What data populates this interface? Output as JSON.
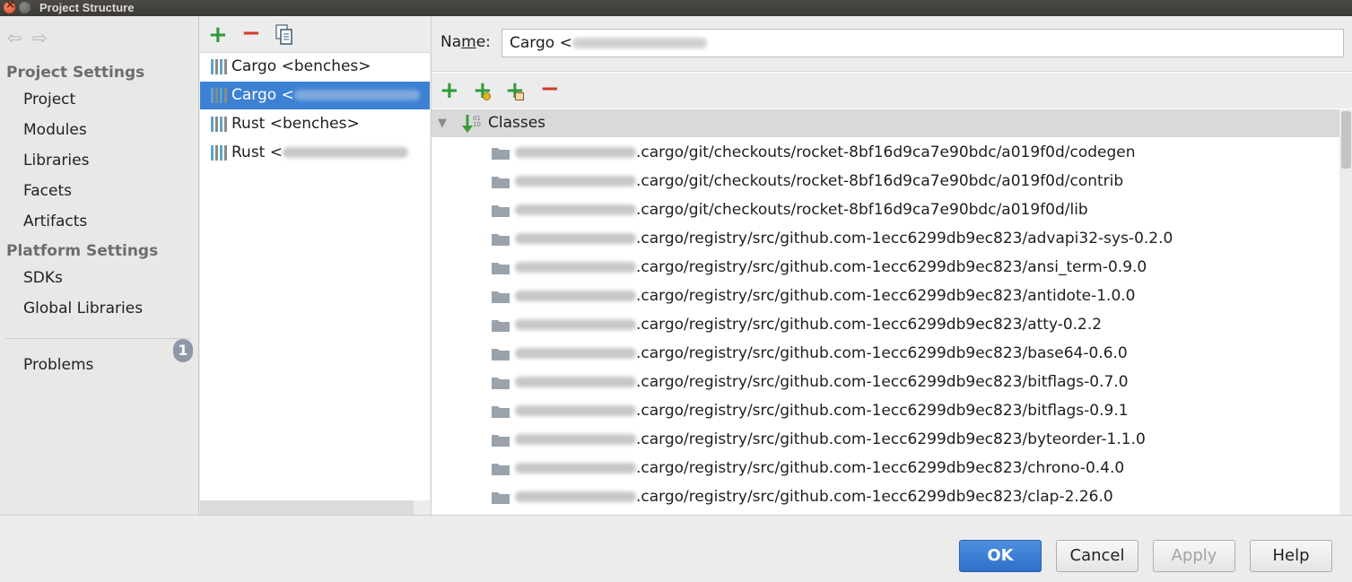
{
  "window": {
    "title": "Project Structure"
  },
  "sidebar": {
    "project_settings_heading": "Project Settings",
    "project_items": [
      "Project",
      "Modules",
      "Libraries",
      "Facets",
      "Artifacts"
    ],
    "platform_settings_heading": "Platform Settings",
    "platform_items": [
      "SDKs",
      "Global Libraries"
    ],
    "problems_label": "Problems",
    "problems_count": "1"
  },
  "libraries": {
    "items": [
      {
        "name": "Cargo <benches>",
        "selected": false,
        "redacted": false
      },
      {
        "name": "Cargo <",
        "selected": true,
        "redacted": true
      },
      {
        "name": "Rust <benches>",
        "selected": false,
        "redacted": false
      },
      {
        "name": "Rust <",
        "selected": false,
        "redacted": true
      }
    ]
  },
  "detail": {
    "name_label_prefix": "Na",
    "name_label_mnemonic": "m",
    "name_label_suffix": "e:",
    "name_value": "Cargo <",
    "classes_label": "Classes",
    "paths": [
      ".cargo/git/checkouts/rocket-8bf16d9ca7e90bdc/a019f0d/codegen",
      ".cargo/git/checkouts/rocket-8bf16d9ca7e90bdc/a019f0d/contrib",
      ".cargo/git/checkouts/rocket-8bf16d9ca7e90bdc/a019f0d/lib",
      ".cargo/registry/src/github.com-1ecc6299db9ec823/advapi32-sys-0.2.0",
      ".cargo/registry/src/github.com-1ecc6299db9ec823/ansi_term-0.9.0",
      ".cargo/registry/src/github.com-1ecc6299db9ec823/antidote-1.0.0",
      ".cargo/registry/src/github.com-1ecc6299db9ec823/atty-0.2.2",
      ".cargo/registry/src/github.com-1ecc6299db9ec823/base64-0.6.0",
      ".cargo/registry/src/github.com-1ecc6299db9ec823/bitflags-0.7.0",
      ".cargo/registry/src/github.com-1ecc6299db9ec823/bitflags-0.9.1",
      ".cargo/registry/src/github.com-1ecc6299db9ec823/byteorder-1.1.0",
      ".cargo/registry/src/github.com-1ecc6299db9ec823/chrono-0.4.0",
      ".cargo/registry/src/github.com-1ecc6299db9ec823/clap-2.26.0"
    ]
  },
  "buttons": {
    "ok": "OK",
    "cancel": "Cancel",
    "apply": "Apply",
    "help": "Help"
  },
  "colors": {
    "accent": "#3d81d3",
    "add": "#2e9a3a",
    "remove": "#d23a2a"
  }
}
